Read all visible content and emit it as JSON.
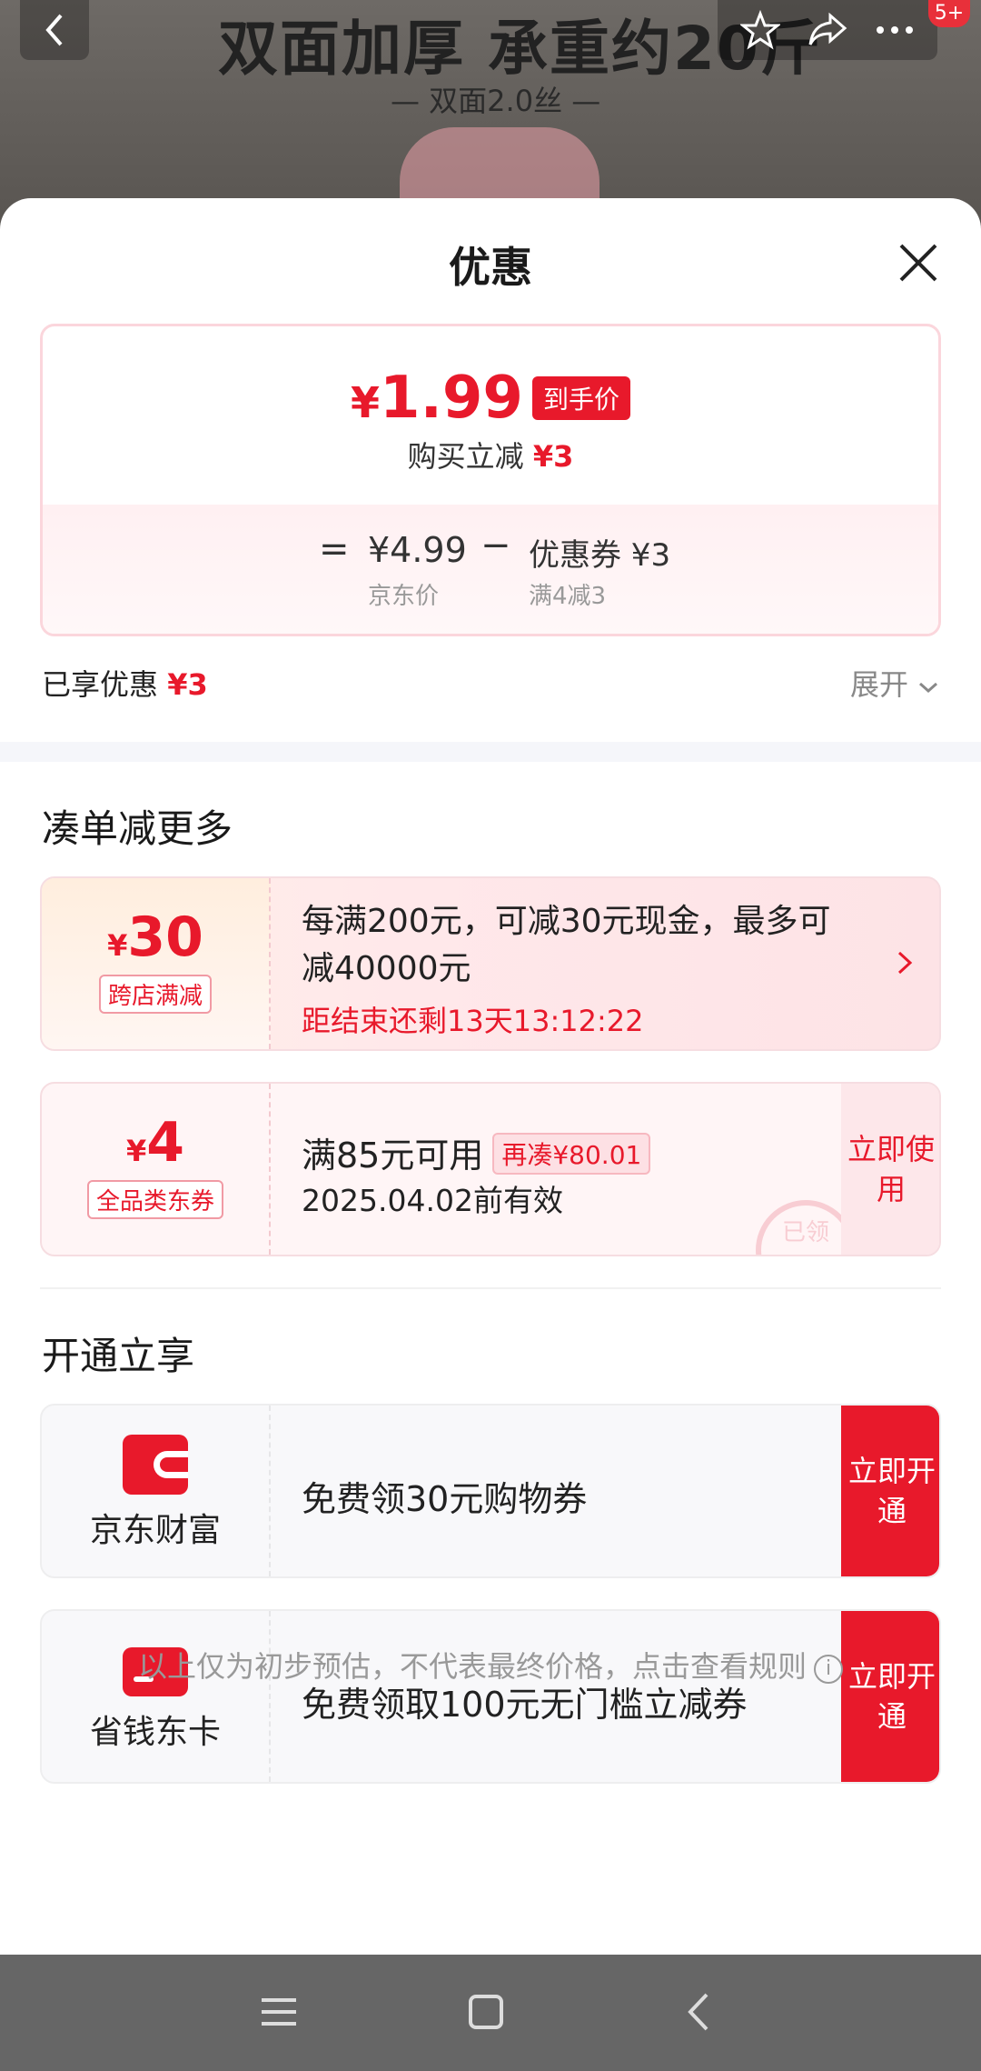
{
  "background": {
    "title": "双面加厚 承重约20斤",
    "subtitle": "— 双面2.0丝 —",
    "badge": "5+"
  },
  "sheet": {
    "title": "优惠",
    "price": {
      "symbol": "¥",
      "amount": "1.99",
      "tag": "到手价",
      "save_label": "购买立减",
      "save_amount": "¥3",
      "equals": "=",
      "jd_price": "¥4.99",
      "jd_price_label": "京东价",
      "minus": "−",
      "coupon": "优惠券 ¥3",
      "coupon_rule": "满4减3"
    },
    "enjoyed_label": "已享优惠",
    "enjoyed_amount": "¥3",
    "expand_label": "展开",
    "section1_title": "凑单减更多",
    "ticket1": {
      "symbol": "¥",
      "amount": "30",
      "label": "跨店满减",
      "text": "每满200元，可减30元现金，最多可减40000元",
      "timer": "距结束还剩13天13:12:22"
    },
    "ticket2": {
      "symbol": "¥",
      "amount": "4",
      "label": "全品类东券",
      "text": "满85元可用",
      "tag": "再凑¥80.01",
      "date": "2025.04.02前有效",
      "button": "立即使用",
      "stamp": "已领"
    },
    "section2_title": "开通立享",
    "service1": {
      "name": "京东财富",
      "text": "免费领30元购物券",
      "button": "立即开通"
    },
    "service2": {
      "name": "省钱东卡",
      "text": "免费领取100元无门槛立减券",
      "button": "立即开通"
    },
    "footer_note": "以上仅为初步预估，不代表最终价格，点击查看规则"
  },
  "colors": {
    "accent": "#e8192b",
    "panel_bg": "#ffffff",
    "divider": "#f5f6fa"
  },
  "icons": [
    "back-icon",
    "star-icon",
    "share-icon",
    "more-icon",
    "close-icon",
    "chevron-down-icon",
    "chevron-right-icon",
    "wallet-icon",
    "card-icon",
    "info-icon",
    "menu-icon",
    "home-icon",
    "nav-back-icon"
  ]
}
